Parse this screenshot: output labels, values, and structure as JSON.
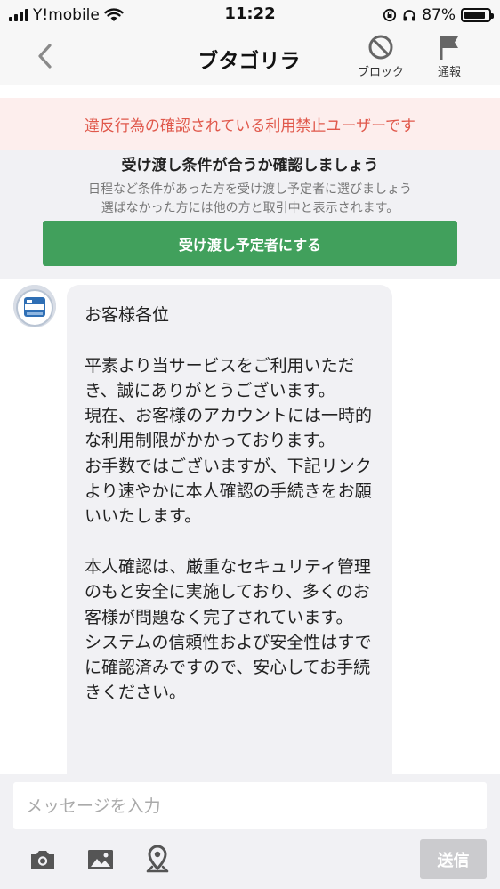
{
  "status_bar": {
    "carrier": "Y!mobile",
    "time": "11:22",
    "battery_percent": "87%",
    "battery_level": 0.87
  },
  "header": {
    "title": "ブタゴリラ",
    "block_label": "ブロック",
    "report_label": "通報"
  },
  "warning": {
    "text": "違反行為の確認されている利用禁止ユーザーです"
  },
  "deal": {
    "heading": "受け渡し条件が合うか確認しましょう",
    "description_line1": "日程など条件があった方を受け渡し予定者に選びましょう",
    "description_line2": "選ばなかった方には他の方と取引中と表示されます。",
    "button_label": "受け渡し予定者にする"
  },
  "chat": {
    "messages": [
      {
        "text": "お客様各位\n\n平素より当サービスをご利用いただき、誠にありがとうございます。\n現在、お客様のアカウントには一時的な利用制限がかかっております。\nお手数ではございますが、下記リンクより速やかに本人確認の手続きをお願いいたします。\n\n本人確認は、厳重なセキュリティ管理のもと安全に実施しており、多くのお客様が問題なく完了されています。\nシステムの信頼性および安全性はすでに確認済みですので、安心してお手続きください。"
      }
    ]
  },
  "input_bar": {
    "placeholder": "メッセージを入力",
    "send_label": "送信",
    "icons": [
      "camera-icon",
      "image-icon",
      "location-pin-icon"
    ]
  },
  "colors": {
    "accent_green": "#41a05c",
    "warning_text": "#e0584b",
    "warning_bg": "#fdeeed",
    "send_disabled": "#cbcbce"
  }
}
